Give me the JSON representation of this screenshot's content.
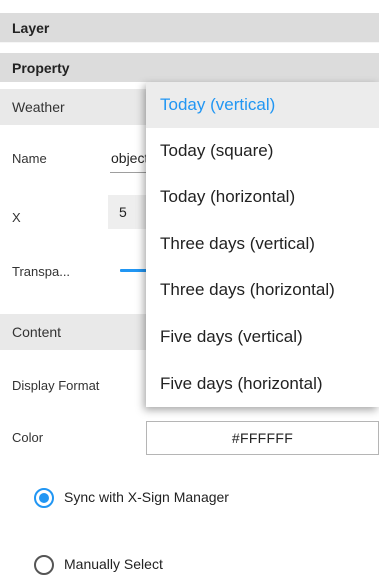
{
  "sections": {
    "layer": "Layer",
    "property": "Property",
    "weather": "Weather",
    "content": "Content"
  },
  "fields": {
    "name_label": "Name",
    "name_value": "object",
    "x_label": "X",
    "x_value": "5",
    "transparency_label": "Transpa...",
    "display_format_label": "Display Format",
    "color_label": "Color",
    "color_value": "#FFFFFF"
  },
  "radios": [
    {
      "label": "Sync with X-Sign Manager",
      "selected": true
    },
    {
      "label": "Manually Select",
      "selected": false
    }
  ],
  "dropdown": {
    "items": [
      {
        "label": "Today (vertical)",
        "selected": true
      },
      {
        "label": "Today (square)",
        "selected": false
      },
      {
        "label": "Today (horizontal)",
        "selected": false
      },
      {
        "label": "Three days (vertical)",
        "selected": false
      },
      {
        "label": "Three days (horizontal)",
        "selected": false
      },
      {
        "label": "Five days (vertical)",
        "selected": false
      },
      {
        "label": "Five days (horizontal)",
        "selected": false
      }
    ]
  },
  "colors": {
    "accent": "#2196f3",
    "header_dark": "#dcdcdc",
    "header_light": "#e9e9e9"
  }
}
